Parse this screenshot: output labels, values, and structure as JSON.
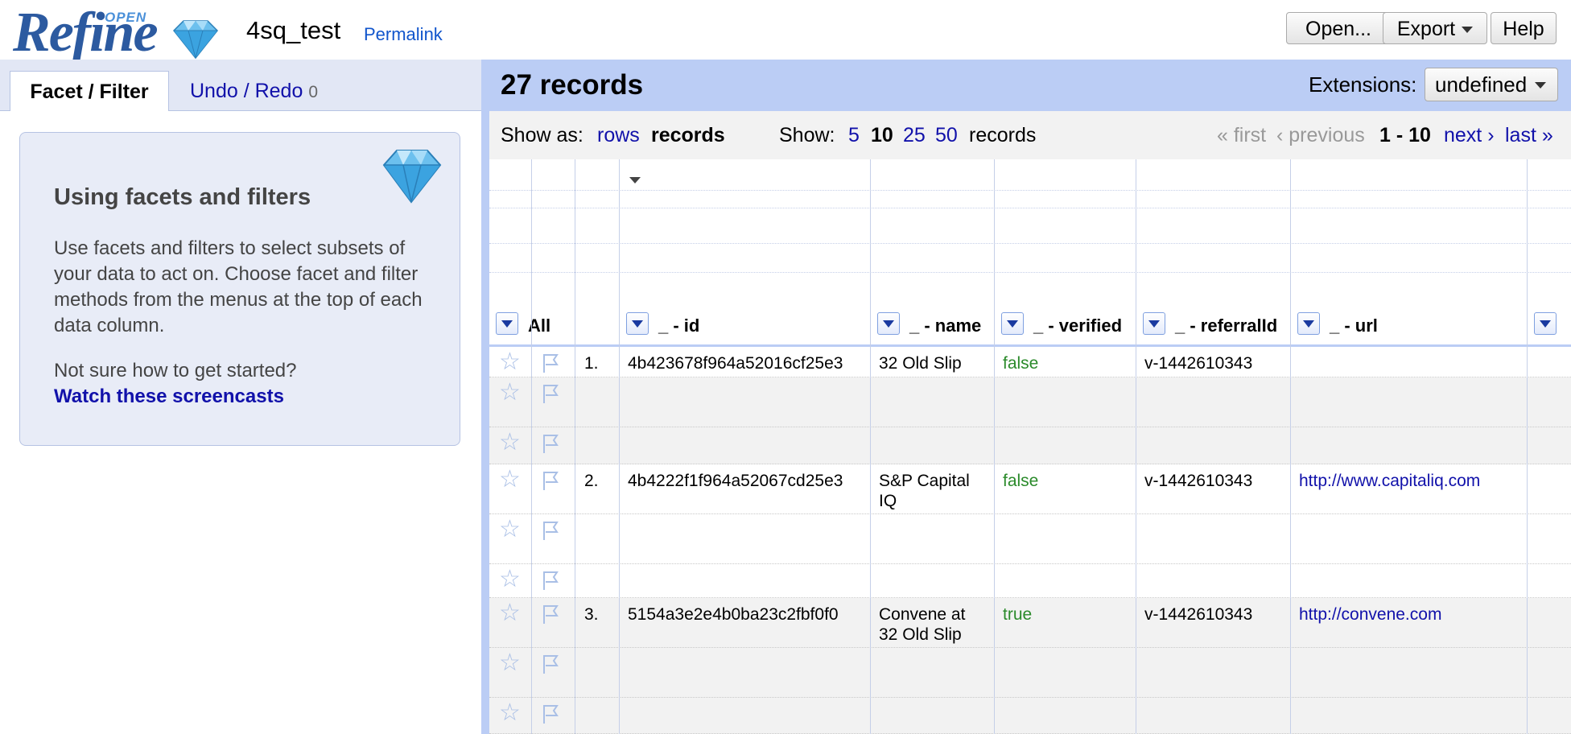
{
  "header": {
    "logo_word": "Refine",
    "logo_open": "OPEN",
    "project_name": "4sq_test",
    "permalink": "Permalink",
    "buttons": {
      "open": "Open...",
      "export": "Export",
      "help": "Help"
    }
  },
  "left_panel": {
    "tabs": {
      "facet": "Facet / Filter",
      "undo": "Undo / Redo",
      "undo_count": "0"
    },
    "help": {
      "title": "Using facets and filters",
      "text": "Use facets and filters to select subsets of your data to act on. Choose facet and filter methods from the menus at the top of each data column.",
      "question": "Not sure how to get started?",
      "link": "Watch these screencasts"
    }
  },
  "summary": {
    "record_count": "27 records",
    "extensions_label": "Extensions:",
    "extensions_value": "undefined"
  },
  "view_bar": {
    "show_as": "Show as:",
    "rows": "rows",
    "records": "records",
    "show": "Show:",
    "sizes": [
      "5",
      "10",
      "25",
      "50"
    ],
    "records_suffix": "records",
    "first": "« first",
    "previous": "‹ previous",
    "range": "1 - 10",
    "next": "next ›",
    "last": "last »"
  },
  "columns": {
    "all": "All",
    "id": "_ - id",
    "name": "_ - name",
    "verified": "_ - verified",
    "referral": "_ - referralId",
    "url": "_ - url"
  },
  "rows": [
    {
      "index": "1.",
      "id": "4b423678f964a52016cf25e3",
      "name": "32 Old Slip",
      "verified": "false",
      "referral": "v-1442610343",
      "url": ""
    },
    {
      "index": "",
      "id": "",
      "name": "",
      "verified": "",
      "referral": "",
      "url": ""
    },
    {
      "index": "",
      "id": "",
      "name": "",
      "verified": "",
      "referral": "",
      "url": ""
    },
    {
      "index": "2.",
      "id": "4b4222f1f964a52067cd25e3",
      "name": "S&P Capital IQ",
      "verified": "false",
      "referral": "v-1442610343",
      "url": "http://www.capitaliq.com"
    },
    {
      "index": "",
      "id": "",
      "name": "",
      "verified": "",
      "referral": "",
      "url": ""
    },
    {
      "index": "",
      "id": "",
      "name": "",
      "verified": "",
      "referral": "",
      "url": ""
    },
    {
      "index": "3.",
      "id": "5154a3e2e4b0ba23c2fbf0f0",
      "name": "Convene at 32 Old Slip",
      "verified": "true",
      "referral": "v-1442610343",
      "url": "http://convene.com"
    },
    {
      "index": "",
      "id": "",
      "name": "",
      "verified": "",
      "referral": "",
      "url": ""
    },
    {
      "index": "",
      "id": "",
      "name": "",
      "verified": "",
      "referral": "",
      "url": ""
    }
  ],
  "colors": {
    "accent": "#bbcdf5",
    "link": "#1111aa",
    "verified": "#2a8a2a"
  }
}
